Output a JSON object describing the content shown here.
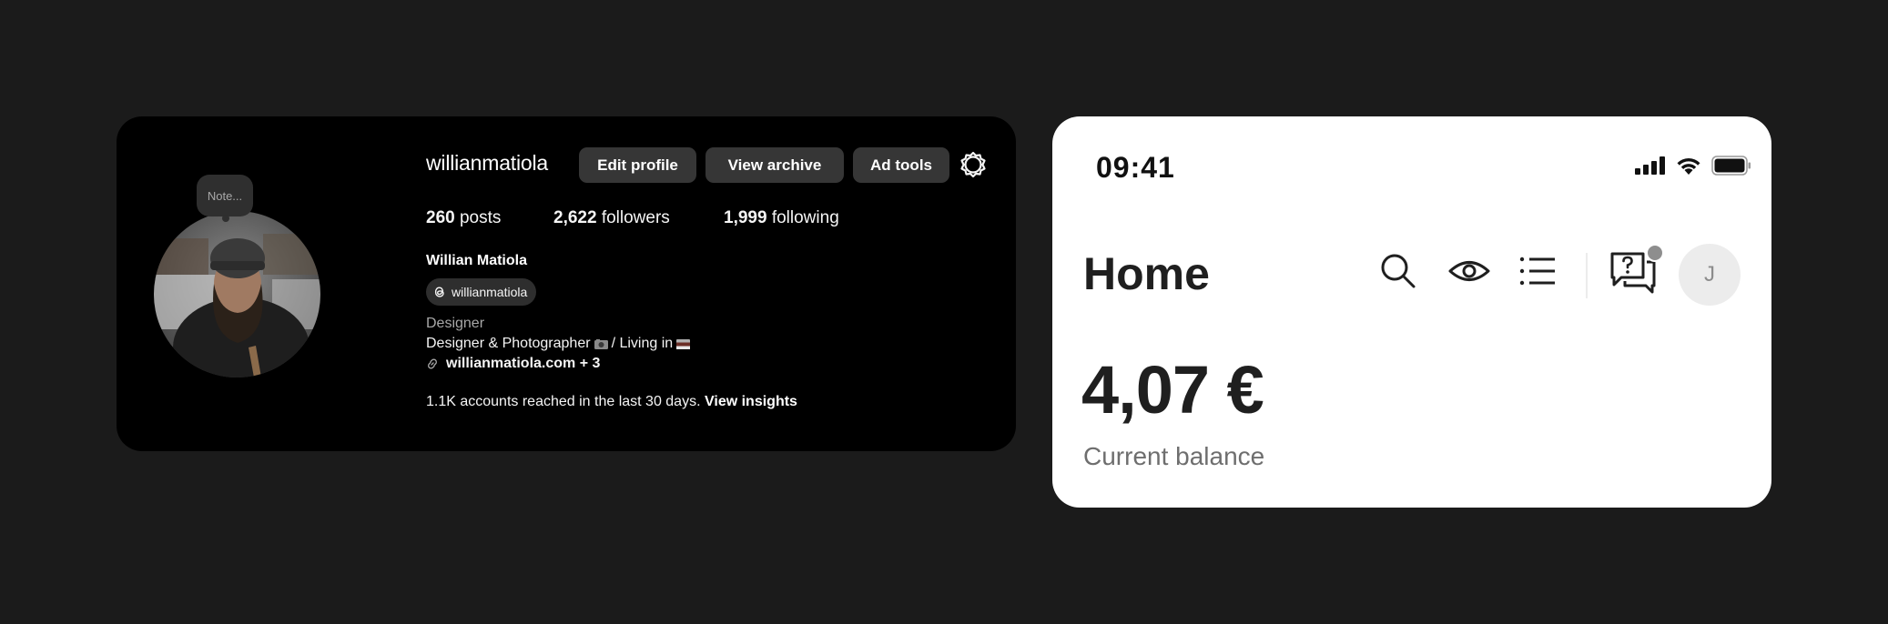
{
  "profile": {
    "note": "Note...",
    "username": "willianmatiola",
    "buttons": {
      "edit": "Edit profile",
      "archive": "View archive",
      "ad_tools": "Ad tools"
    },
    "stats": {
      "posts_count": "260",
      "posts_label": "posts",
      "followers_count": "2,622",
      "followers_label": "followers",
      "following_count": "1,999",
      "following_label": "following"
    },
    "full_name": "Willian Matiola",
    "threads_handle": "willianmatiola",
    "category": "Designer",
    "bio_part1": "Designer & Photographer",
    "bio_part2": "/ Living in",
    "website": "willianmatiola.com + 3",
    "insights_text": "1.1K accounts reached in the last 30 days.",
    "insights_link": "View insights"
  },
  "phone": {
    "time": "09:41",
    "title": "Home",
    "avatar_initial": "J",
    "balance": "4,07 €",
    "balance_label": "Current balance",
    "icons": [
      "search-icon",
      "eye-icon",
      "list-icon",
      "help-chat-icon"
    ]
  },
  "colors": {
    "background": "#1b1b1b",
    "profile_card": "#000000",
    "button": "#363636",
    "phone_card": "#ffffff"
  }
}
